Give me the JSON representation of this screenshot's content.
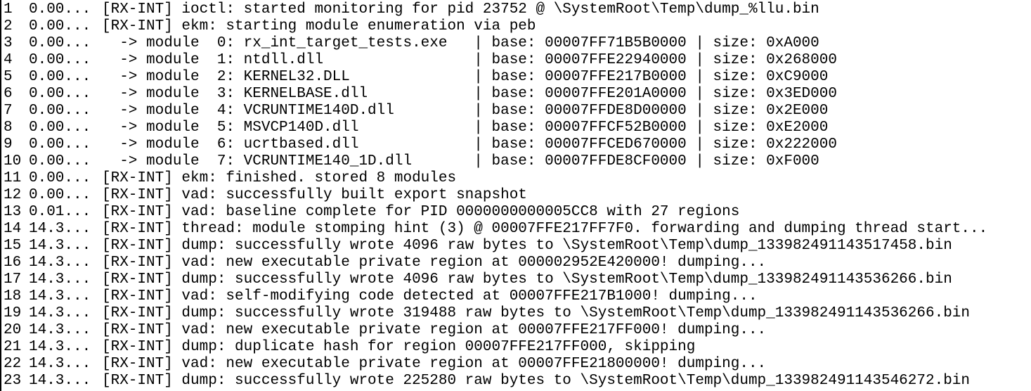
{
  "log": {
    "lines": [
      {
        "n": "1",
        "t": "0.00...",
        "msg": "[RX-INT] ioctl: started monitoring for pid 23752 @ \\SystemRoot\\Temp\\dump_%llu.bin"
      },
      {
        "n": "2",
        "t": "0.00...",
        "msg": "[RX-INT] ekm: starting module enumeration via peb"
      },
      {
        "n": "3",
        "t": "0.00...",
        "msg": "  -> module  0: rx_int_target_tests.exe   | base: 00007FF71B5B0000 | size: 0xA000"
      },
      {
        "n": "4",
        "t": "0.00...",
        "msg": "  -> module  1: ntdll.dll                 | base: 00007FFE22940000 | size: 0x268000"
      },
      {
        "n": "5",
        "t": "0.00...",
        "msg": "  -> module  2: KERNEL32.DLL              | base: 00007FFE217B0000 | size: 0xC9000"
      },
      {
        "n": "6",
        "t": "0.00...",
        "msg": "  -> module  3: KERNELBASE.dll            | base: 00007FFE201A0000 | size: 0x3ED000"
      },
      {
        "n": "7",
        "t": "0.00...",
        "msg": "  -> module  4: VCRUNTIME140D.dll         | base: 00007FFDE8D00000 | size: 0x2E000"
      },
      {
        "n": "8",
        "t": "0.00...",
        "msg": "  -> module  5: MSVCP140D.dll             | base: 00007FFCF52B0000 | size: 0xE2000"
      },
      {
        "n": "9",
        "t": "0.00...",
        "msg": "  -> module  6: ucrtbased.dll             | base: 00007FFCED670000 | size: 0x222000"
      },
      {
        "n": "10",
        "t": "0.00...",
        "msg": "  -> module  7: VCRUNTIME140_1D.dll       | base: 00007FFDE8CF0000 | size: 0xF000"
      },
      {
        "n": "11",
        "t": "0.00...",
        "msg": "[RX-INT] ekm: finished. stored 8 modules"
      },
      {
        "n": "12",
        "t": "0.00...",
        "msg": "[RX-INT] vad: successfully built export snapshot"
      },
      {
        "n": "13",
        "t": "0.01...",
        "msg": "[RX-INT] vad: baseline complete for PID 0000000000005CC8 with 27 regions"
      },
      {
        "n": "14",
        "t": "14.3...",
        "msg": "[RX-INT] thread: module stomping hint (3) @ 00007FFE217FF7F0. forwarding and dumping thread start..."
      },
      {
        "n": "15",
        "t": "14.3...",
        "msg": "[RX-INT] dump: successfully wrote 4096 raw bytes to \\SystemRoot\\Temp\\dump_133982491143517458.bin"
      },
      {
        "n": "16",
        "t": "14.3...",
        "msg": "[RX-INT] vad: new executable private region at 000002952E420000! dumping..."
      },
      {
        "n": "17",
        "t": "14.3...",
        "msg": "[RX-INT] dump: successfully wrote 4096 raw bytes to \\SystemRoot\\Temp\\dump_133982491143536266.bin"
      },
      {
        "n": "18",
        "t": "14.3...",
        "msg": "[RX-INT] vad: self-modifying code detected at 00007FFE217B1000! dumping..."
      },
      {
        "n": "19",
        "t": "14.3...",
        "msg": "[RX-INT] dump: successfully wrote 319488 raw bytes to \\SystemRoot\\Temp\\dump_133982491143536266.bin"
      },
      {
        "n": "20",
        "t": "14.3...",
        "msg": "[RX-INT] vad: new executable private region at 00007FFE217FF000! dumping..."
      },
      {
        "n": "21",
        "t": "14.3...",
        "msg": "[RX-INT] dump: duplicate hash for region 00007FFE217FF000, skipping"
      },
      {
        "n": "22",
        "t": "14.3...",
        "msg": "[RX-INT] vad: new executable private region at 00007FFE21800000! dumping..."
      },
      {
        "n": "23",
        "t": "14.3...",
        "msg": "[RX-INT] dump: successfully wrote 225280 raw bytes to \\SystemRoot\\Temp\\dump_133982491143546272.bin"
      }
    ]
  }
}
